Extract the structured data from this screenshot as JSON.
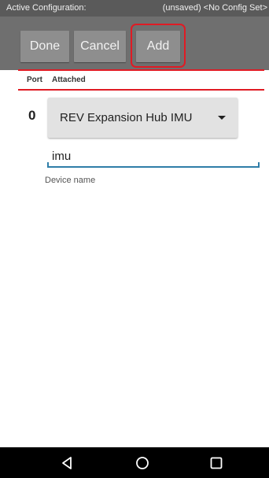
{
  "config_bar": {
    "label": "Active Configuration:",
    "value": "(unsaved) <No Config Set>"
  },
  "toolbar": {
    "done_label": "Done",
    "cancel_label": "Cancel",
    "add_label": "Add"
  },
  "table_header": {
    "port": "Port",
    "attached": "Attached"
  },
  "device": {
    "port": "0",
    "type": "REV Expansion Hub IMU",
    "name": "imu",
    "name_hint": "Device name"
  },
  "nav": {
    "back_icon": "back-triangle-icon",
    "home_icon": "home-circle-icon",
    "recent_icon": "recent-square-icon"
  },
  "colors": {
    "highlight": "#e01b24",
    "toolbar": "#6f6f6f",
    "accent_underline": "#2f7ea8"
  }
}
